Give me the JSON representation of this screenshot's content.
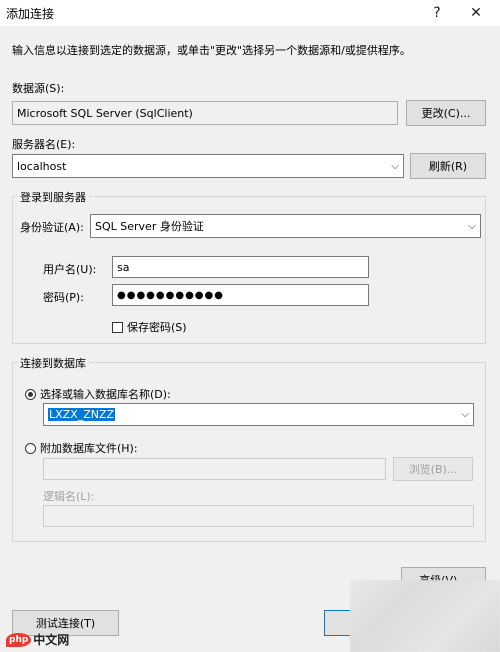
{
  "window": {
    "title": "添加连接",
    "help": "?",
    "close": "✕"
  },
  "intro": "输入信息以连接到选定的数据源，或单击\"更改\"选择另一个数据源和/或提供程序。",
  "datasource": {
    "label": "数据源(S):",
    "value": "Microsoft SQL Server (SqlClient)",
    "change_button": "更改(C)..."
  },
  "server": {
    "label": "服务器名(E):",
    "value": "localhost",
    "refresh_button": "刷新(R)"
  },
  "login": {
    "group_title": "登录到服务器",
    "auth_label": "身份验证(A):",
    "auth_value": "SQL Server 身份验证",
    "user_label": "用户名(U):",
    "user_value": "sa",
    "password_label": "密码(P):",
    "password_value": "●●●●●●●●●●●",
    "save_password_label": "保存密码(S)"
  },
  "database": {
    "group_title": "连接到数据库",
    "select_label": "选择或输入数据库名称(D):",
    "select_value": "LXZX_ZNZZ",
    "attach_label": "附加数据库文件(H):",
    "browse_button": "浏览(B)...",
    "logical_label": "逻辑名(L):"
  },
  "buttons": {
    "advanced": "高级(V)...",
    "test": "测试连接(T)"
  },
  "watermark": {
    "brand": "php",
    "site": "中文网"
  }
}
